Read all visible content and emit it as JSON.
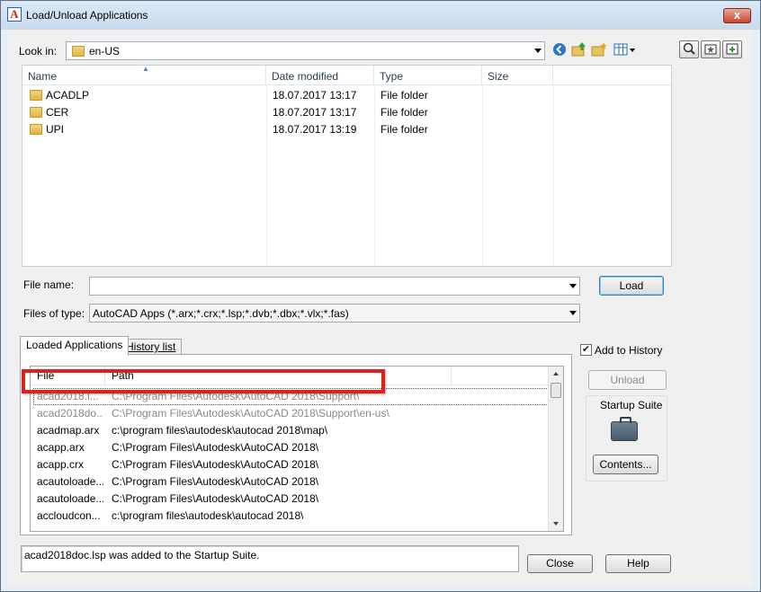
{
  "window": {
    "title": "Load/Unload Applications",
    "close_glyph": "x"
  },
  "lookin": {
    "label": "Look in:",
    "value": "en-US",
    "icons": [
      "back-icon",
      "up-folder-icon",
      "new-folder-icon",
      "views-menu-icon"
    ],
    "right_tools": [
      "find-icon",
      "add-to-favorites-icon",
      "add-to-favorites-tools-icon"
    ]
  },
  "filelist": {
    "headers": [
      "Name",
      "Date modified",
      "Type",
      "Size"
    ],
    "rows": [
      {
        "name": "ACADLP",
        "date": "18.07.2017 13:17",
        "type": "File folder",
        "size": ""
      },
      {
        "name": "CER",
        "date": "18.07.2017 13:17",
        "type": "File folder",
        "size": ""
      },
      {
        "name": "UPI",
        "date": "18.07.2017 13:19",
        "type": "File folder",
        "size": ""
      }
    ]
  },
  "filename": {
    "label": "File name:",
    "value": "",
    "load_label": "Load"
  },
  "filetype": {
    "label": "Files of type:",
    "value": "AutoCAD Apps (*.arx;*.crx;*.lsp;*.dvb;*.dbx;*.vlx;*.fas)"
  },
  "tabs": [
    "Loaded Applications",
    "History list"
  ],
  "apps": {
    "headers": [
      "File",
      "Path"
    ],
    "rows": [
      {
        "file": "acad2018.l...",
        "path": "C:\\Program Files\\Autodesk\\AutoCAD 2018\\Support\\",
        "state": "grey"
      },
      {
        "file": "acad2018do...",
        "path": "C:\\Program Files\\Autodesk\\AutoCAD 2018\\Support\\en-us\\",
        "state": "grey"
      },
      {
        "file": "acadmap.arx",
        "path": "c:\\program files\\autodesk\\autocad 2018\\map\\",
        "state": "normal"
      },
      {
        "file": "acapp.arx",
        "path": "C:\\Program Files\\Autodesk\\AutoCAD 2018\\",
        "state": "normal"
      },
      {
        "file": "acapp.crx",
        "path": "C:\\Program Files\\Autodesk\\AutoCAD 2018\\",
        "state": "normal"
      },
      {
        "file": "acautoloade...",
        "path": "C:\\Program Files\\Autodesk\\AutoCAD 2018\\",
        "state": "normal"
      },
      {
        "file": "acautoloade...",
        "path": "C:\\Program Files\\Autodesk\\AutoCAD 2018\\",
        "state": "normal"
      },
      {
        "file": "accloudcon...",
        "path": "c:\\program files\\autodesk\\autocad 2018\\",
        "state": "normal"
      }
    ]
  },
  "history": {
    "label": "Add to History",
    "checked": true
  },
  "unload_label": "Unload",
  "startup_suite": {
    "title": "Startup Suite",
    "contents_label": "Contents..."
  },
  "status_text": "acad2018doc.lsp was added to the Startup Suite.",
  "close_label": "Close",
  "help_label": "Help",
  "colors": {
    "highlight_box": "#d9231d",
    "title_bar": "#c9dbee"
  }
}
